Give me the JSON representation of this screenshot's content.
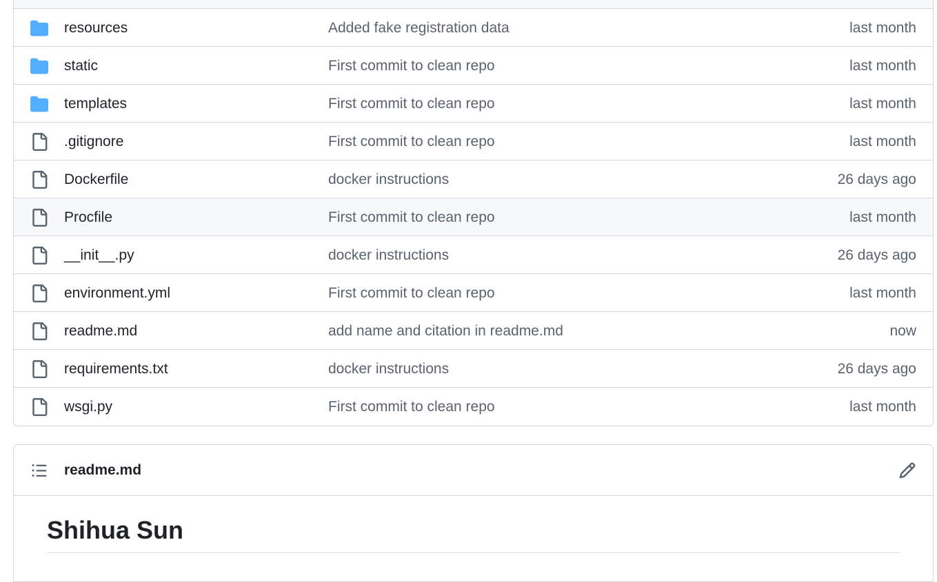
{
  "files": [
    {
      "type": "folder",
      "icon": "folder-icon",
      "name": "resources",
      "message": "Added fake registration data",
      "age": "last month"
    },
    {
      "type": "folder",
      "icon": "folder-icon",
      "name": "static",
      "message": "First commit to clean repo",
      "age": "last month"
    },
    {
      "type": "folder",
      "icon": "folder-icon",
      "name": "templates",
      "message": "First commit to clean repo",
      "age": "last month"
    },
    {
      "type": "file",
      "icon": "file-icon",
      "name": ".gitignore",
      "message": "First commit to clean repo",
      "age": "last month"
    },
    {
      "type": "file",
      "icon": "file-icon",
      "name": "Dockerfile",
      "message": "docker instructions",
      "age": "26 days ago"
    },
    {
      "type": "file",
      "icon": "file-icon",
      "name": "Procfile",
      "message": "First commit to clean repo",
      "age": "last month"
    },
    {
      "type": "file",
      "icon": "file-icon",
      "name": "__init__.py",
      "message": "docker instructions",
      "age": "26 days ago"
    },
    {
      "type": "file",
      "icon": "file-icon",
      "name": "environment.yml",
      "message": "First commit to clean repo",
      "age": "last month"
    },
    {
      "type": "file",
      "icon": "file-icon",
      "name": "readme.md",
      "message": "add name and citation in readme.md",
      "age": "now"
    },
    {
      "type": "file",
      "icon": "file-icon",
      "name": "requirements.txt",
      "message": "docker instructions",
      "age": "26 days ago"
    },
    {
      "type": "file",
      "icon": "file-icon",
      "name": "wsgi.py",
      "message": "First commit to clean repo",
      "age": "last month"
    }
  ],
  "hovered_row": "Procfile",
  "readme": {
    "filename": "readme.md",
    "toc_icon": "list-unordered-icon",
    "edit_icon": "pencil-icon",
    "heading": "Shihua Sun"
  },
  "colors": {
    "folder": "#54aeff",
    "file_icon": "#59636e",
    "border": "#d0d7de",
    "muted_text": "#59636e",
    "hover_bg": "#f6f8fa"
  }
}
